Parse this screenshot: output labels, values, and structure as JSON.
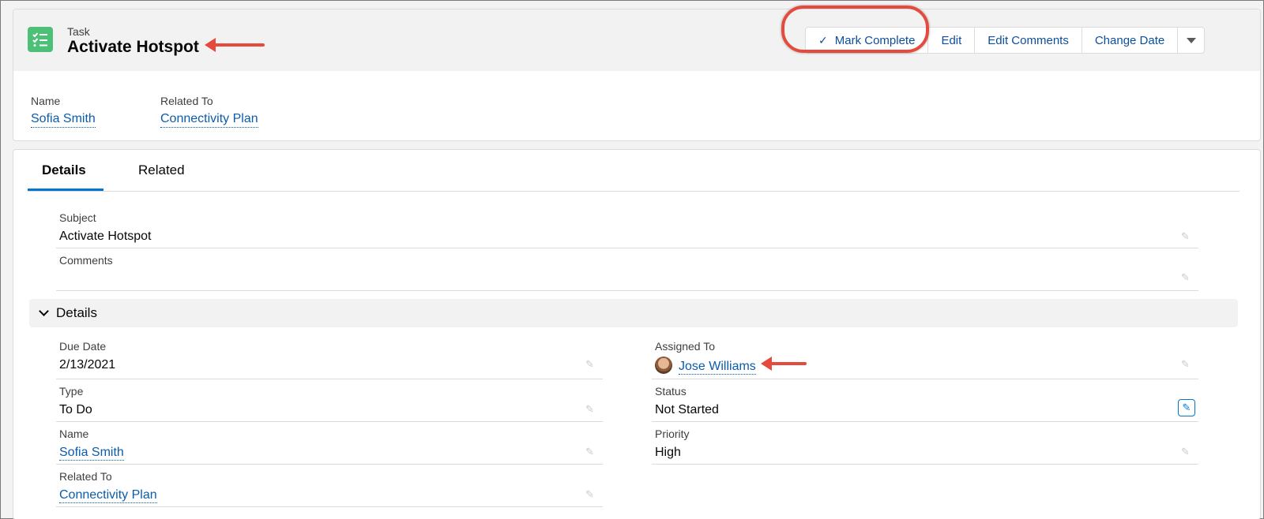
{
  "header": {
    "object_label": "Task",
    "title": "Activate Hotspot",
    "icon": "task-checklist-icon",
    "icon_color": "#4bc076",
    "actions": {
      "mark_complete": "Mark Complete",
      "edit": "Edit",
      "edit_comments": "Edit Comments",
      "change_date": "Change Date"
    },
    "highlights": {
      "name_label": "Name",
      "name_value": "Sofia Smith",
      "related_label": "Related To",
      "related_value": "Connectivity Plan"
    }
  },
  "tabs": {
    "details": "Details",
    "related": "Related"
  },
  "fields": {
    "subject_label": "Subject",
    "subject_value": "Activate Hotspot",
    "comments_label": "Comments",
    "comments_value": ""
  },
  "details_section": {
    "title": "Details",
    "due_date_label": "Due Date",
    "due_date_value": "2/13/2021",
    "type_label": "Type",
    "type_value": "To Do",
    "name_label": "Name",
    "name_value": "Sofia Smith",
    "related_label": "Related To",
    "related_value": "Connectivity Plan",
    "assigned_label": "Assigned To",
    "assigned_value": "Jose Williams",
    "status_label": "Status",
    "status_value": "Not Started",
    "priority_label": "Priority",
    "priority_value": "High"
  },
  "colors": {
    "link": "#0b5cab",
    "annotation": "#e44b3d",
    "tab_active": "#0176d3"
  }
}
